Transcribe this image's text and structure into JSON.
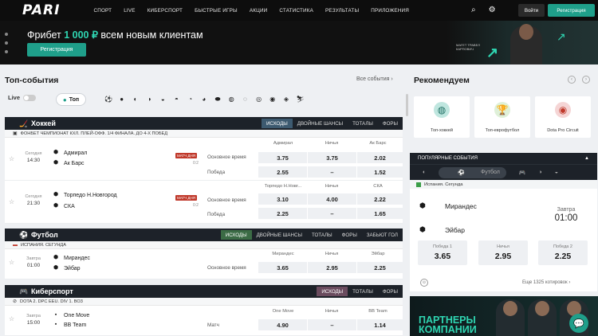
{
  "header": {
    "logo": "PARI",
    "nav": [
      "СПОРТ",
      "LIVE",
      "КИБЕРСПОРТ",
      "БЫСТРЫЕ ИГРЫ",
      "АКЦИИ",
      "СТАТИСТИКА",
      "РЕЗУЛЬТАТЫ",
      "ПРИЛОЖЕНИЯ"
    ],
    "login": "Войти",
    "register": "Регистрация"
  },
  "banner": {
    "text_prefix": "Фрибет ",
    "text_amount": "1 000 ₽",
    "text_suffix": " всем новым клиентам",
    "button": "Регистрация",
    "caption": "МАГЕТ ТРАВЕЛ КАРПОВИЧ"
  },
  "top_events": {
    "title": "Топ-события",
    "all_link": "Все события",
    "live_label": "Live",
    "top_chip": "Топ",
    "sport_icons": [
      "soccer-icon",
      "hockey-icon",
      "basketball-icon",
      "tennis-icon",
      "volleyball-icon",
      "table-tennis-icon",
      "baseball-icon",
      "handball-icon",
      "rugby-icon",
      "football-icon",
      "cricket-icon",
      "snooker-icon",
      "cybersport-icon",
      "darts-icon",
      "ski-icon"
    ]
  },
  "hockey": {
    "title": "Хоккей",
    "tabs": [
      "ИСХОДЫ",
      "ДВОЙНЫЕ ШАНСЫ",
      "ТОТАЛЫ",
      "ФОРЫ"
    ],
    "league": "ФОНБЕТ ЧЕМПИОНАТ КХЛ. ПЛЕЙ-ОФФ. 1/4 ФИНАЛА. ДО 4-Х ПОБЕД",
    "matches": [
      {
        "day": "Сегодня",
        "time": "14:30",
        "team1": "Адмирал",
        "team2": "Ак Барс",
        "badge": "МАТЧ ДНЯ",
        "score": "0:2",
        "h1": "Адмирал",
        "h2": "Ничья",
        "h3": "Ак Барс",
        "m1": "Основное время",
        "o1": [
          "3.75",
          "3.75",
          "2.02"
        ],
        "m2": "Победа",
        "o2": [
          "2.55",
          "–",
          "1.52"
        ]
      },
      {
        "day": "Сегодня",
        "time": "21:30",
        "team1": "Торпедо Н.Новгород",
        "team2": "СКА",
        "badge": "МАТЧ ДНЯ",
        "score": "0:2",
        "h1": "Торпедо Н.Новг...",
        "h2": "Ничья",
        "h3": "СКА",
        "m1": "Основное время",
        "o1": [
          "3.10",
          "4.00",
          "2.22"
        ],
        "m2": "Победа",
        "o2": [
          "2.25",
          "–",
          "1.65"
        ]
      }
    ]
  },
  "football": {
    "title": "Футбол",
    "tabs": [
      "ИСХОДЫ",
      "ДВОЙНЫЕ ШАНСЫ",
      "ТОТАЛЫ",
      "ФОРЫ",
      "ЗАБЬЮТ ГОЛ"
    ],
    "league": "ИСПАНИЯ. СЕГУНДА",
    "match": {
      "day": "Завтра",
      "time": "01:00",
      "team1": "Мирандес",
      "team2": "Эйбар",
      "h1": "Мирандес",
      "h2": "Ничья",
      "h3": "Эйбар",
      "m1": "Основное время",
      "o1": [
        "3.65",
        "2.95",
        "2.25"
      ]
    }
  },
  "esports": {
    "title": "Киберспорт",
    "tabs": [
      "ИСХОДЫ",
      "ТОТАЛЫ",
      "ФОРЫ"
    ],
    "league": "DOTA 2. DPC EEU. DIV 1. BO3",
    "match": {
      "day": "Завтра",
      "time": "15:00",
      "team1": "One Move",
      "team2": "BB Team",
      "h1": "One Move",
      "h2": "Ничья",
      "h3": "BB Team",
      "m1": "Матч",
      "o1": [
        "4.90",
        "–",
        "1.14"
      ]
    }
  },
  "recommend": {
    "title": "Рекомендуем",
    "cards": [
      "Топ-хоккей",
      "Топ-еврофутбол",
      "Dota Pro Circuit"
    ]
  },
  "popular": {
    "title": "ПОПУЛЯРНЫЕ СОБЫТИЯ",
    "active_tab": "Футбол",
    "league": "Испания. Сегунда",
    "team1": "Мирандес",
    "team2": "Эйбар",
    "day": "Завтра",
    "time": "01:00",
    "odds": [
      {
        "label": "Победа 1",
        "value": "3.65"
      },
      {
        "label": "Ничья",
        "value": "2.95"
      },
      {
        "label": "Победа 2",
        "value": "2.25"
      }
    ],
    "more": "Еще 1325 котировок"
  },
  "promo": {
    "line1": "ПАРТНЕРЫ",
    "line2": "КОМПАНИИ"
  },
  "colors": {
    "accent": "#1f9f8a",
    "header_bg": "#0d0d0d",
    "block_head": "#1d2229"
  }
}
